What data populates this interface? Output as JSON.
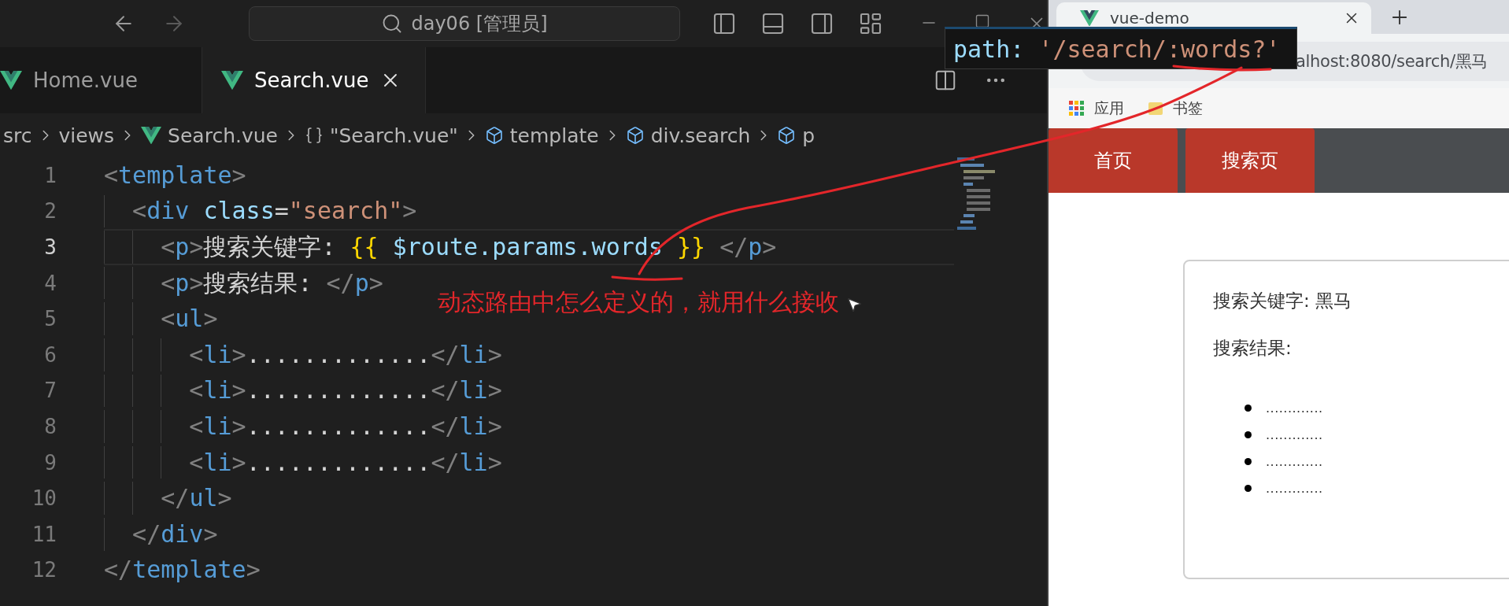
{
  "title_bar": {
    "command_center": "day06 [管理员]"
  },
  "editor_tabs": [
    {
      "label": "Home.vue",
      "selected": false
    },
    {
      "label": "Search.vue",
      "selected": true
    }
  ],
  "breadcrumb": [
    {
      "label": "src",
      "kind": "folder"
    },
    {
      "label": "views",
      "kind": "folder"
    },
    {
      "label": "Search.vue",
      "kind": "vue"
    },
    {
      "label": "\"Search.vue\"",
      "kind": "module"
    },
    {
      "label": "template",
      "kind": "element"
    },
    {
      "label": "div.search",
      "kind": "element"
    },
    {
      "label": "p",
      "kind": "element"
    }
  ],
  "code_lines": [
    {
      "number": "1",
      "active": false,
      "tokens": [
        {
          "text": "<",
          "kind": "punct"
        },
        {
          "text": "template",
          "kind": "tag"
        },
        {
          "text": ">",
          "kind": "punct"
        }
      ]
    },
    {
      "number": "2",
      "active": false,
      "tokens": [
        {
          "text": "  <",
          "kind": "punct"
        },
        {
          "text": "div",
          "kind": "tag"
        },
        {
          "text": " class",
          "kind": "attr"
        },
        {
          "text": "=",
          "kind": "text"
        },
        {
          "text": "\"search\"",
          "kind": "string"
        },
        {
          "text": ">",
          "kind": "punct"
        }
      ]
    },
    {
      "number": "3",
      "active": true,
      "tokens": [
        {
          "text": "    <",
          "kind": "punct"
        },
        {
          "text": "p",
          "kind": "tag"
        },
        {
          "text": ">",
          "kind": "punct"
        },
        {
          "text": "搜索关键字: ",
          "kind": "text"
        },
        {
          "text": "{{",
          "kind": "brace"
        },
        {
          "text": " $route.params.words",
          "kind": "var"
        },
        {
          "text": " }}",
          "kind": "brace"
        },
        {
          "text": " </",
          "kind": "punct"
        },
        {
          "text": "p",
          "kind": "tag"
        },
        {
          "text": ">",
          "kind": "punct"
        }
      ]
    },
    {
      "number": "4",
      "active": false,
      "tokens": [
        {
          "text": "    <",
          "kind": "punct"
        },
        {
          "text": "p",
          "kind": "tag"
        },
        {
          "text": ">",
          "kind": "punct"
        },
        {
          "text": "搜索结果: ",
          "kind": "text"
        },
        {
          "text": "</",
          "kind": "punct"
        },
        {
          "text": "p",
          "kind": "tag"
        },
        {
          "text": ">",
          "kind": "punct"
        }
      ]
    },
    {
      "number": "5",
      "active": false,
      "tokens": [
        {
          "text": "    <",
          "kind": "punct"
        },
        {
          "text": "ul",
          "kind": "tag"
        },
        {
          "text": ">",
          "kind": "punct"
        }
      ]
    },
    {
      "number": "6",
      "active": false,
      "tokens": [
        {
          "text": "      <",
          "kind": "punct"
        },
        {
          "text": "li",
          "kind": "tag"
        },
        {
          "text": ">",
          "kind": "punct"
        },
        {
          "text": ".............",
          "kind": "text"
        },
        {
          "text": "</",
          "kind": "punct"
        },
        {
          "text": "li",
          "kind": "tag"
        },
        {
          "text": ">",
          "kind": "punct"
        }
      ]
    },
    {
      "number": "7",
      "active": false,
      "tokens": [
        {
          "text": "      <",
          "kind": "punct"
        },
        {
          "text": "li",
          "kind": "tag"
        },
        {
          "text": ">",
          "kind": "punct"
        },
        {
          "text": ".............",
          "kind": "text"
        },
        {
          "text": "</",
          "kind": "punct"
        },
        {
          "text": "li",
          "kind": "tag"
        },
        {
          "text": ">",
          "kind": "punct"
        }
      ]
    },
    {
      "number": "8",
      "active": false,
      "tokens": [
        {
          "text": "      <",
          "kind": "punct"
        },
        {
          "text": "li",
          "kind": "tag"
        },
        {
          "text": ">",
          "kind": "punct"
        },
        {
          "text": ".............",
          "kind": "text"
        },
        {
          "text": "</",
          "kind": "punct"
        },
        {
          "text": "li",
          "kind": "tag"
        },
        {
          "text": ">",
          "kind": "punct"
        }
      ]
    },
    {
      "number": "9",
      "active": false,
      "tokens": [
        {
          "text": "      <",
          "kind": "punct"
        },
        {
          "text": "li",
          "kind": "tag"
        },
        {
          "text": ">",
          "kind": "punct"
        },
        {
          "text": ".............",
          "kind": "text"
        },
        {
          "text": "</",
          "kind": "punct"
        },
        {
          "text": "li",
          "kind": "tag"
        },
        {
          "text": ">",
          "kind": "punct"
        }
      ]
    },
    {
      "number": "10",
      "active": false,
      "tokens": [
        {
          "text": "    </",
          "kind": "punct"
        },
        {
          "text": "ul",
          "kind": "tag"
        },
        {
          "text": ">",
          "kind": "punct"
        }
      ]
    },
    {
      "number": "11",
      "active": false,
      "tokens": [
        {
          "text": "  </",
          "kind": "punct"
        },
        {
          "text": "div",
          "kind": "tag"
        },
        {
          "text": ">",
          "kind": "punct"
        }
      ]
    },
    {
      "number": "12",
      "active": false,
      "tokens": [
        {
          "text": "</",
          "kind": "punct"
        },
        {
          "text": "template",
          "kind": "tag"
        },
        {
          "text": ">",
          "kind": "punct"
        }
      ]
    }
  ],
  "hover_tooltip": {
    "tokens": [
      {
        "text": "path:",
        "kind": "attr"
      },
      {
        "text": " '/search/:words?'",
        "kind": "string"
      }
    ]
  },
  "annotation": {
    "text": "动态路由中怎么定义的，就用什么接收"
  },
  "browser": {
    "tab": "vue-demo",
    "address": "alhost:8080/search/黑马",
    "bookmarks": [
      {
        "label": "应用",
        "kind": "apps"
      },
      {
        "label": "书签",
        "kind": "folder"
      }
    ],
    "nav_links": [
      "首页",
      "搜索页"
    ],
    "page": {
      "keyword_line": "搜索关键字: 黑马",
      "results_label": "搜索结果:",
      "results": [
        ".............",
        ".............",
        ".............",
        "............."
      ]
    }
  }
}
